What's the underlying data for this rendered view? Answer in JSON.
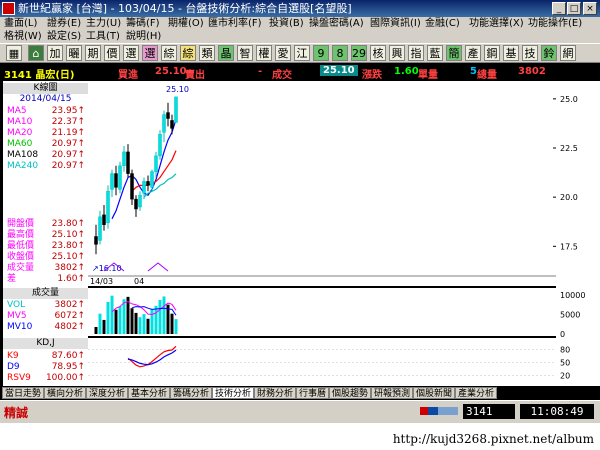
{
  "window": {
    "title": "新世紀贏家 [台灣] - 103/04/15 - 台盤技術分析:綜合自選股[名望股]"
  },
  "menu": {
    "row1": [
      "畫面(L)",
      "證券(E)",
      "主力(U)",
      "籌碼(F)",
      "期權(O)",
      "匯市利率(F)",
      "投資(B)",
      "操盤密碼(A)",
      "國際資訊(I)",
      "金融(C)",
      "功能選擇(X)",
      "功能操作(E)"
    ],
    "row2": [
      "格視(W)",
      "設定(S)",
      "工具(T)",
      "說明(H)"
    ]
  },
  "toolbar": {
    "buttons": [
      {
        "label": "⌂",
        "style": "home"
      },
      {
        "label": "加",
        "style": ""
      },
      {
        "label": "曬",
        "style": ""
      },
      {
        "label": "期",
        "style": ""
      },
      {
        "label": "價",
        "style": ""
      },
      {
        "label": "選",
        "style": ""
      },
      {
        "label": "選",
        "style": "pink"
      },
      {
        "label": "綜",
        "style": ""
      },
      {
        "label": "綜",
        "style": "yellow"
      },
      {
        "label": "類",
        "style": ""
      },
      {
        "label": "晶",
        "style": "green"
      },
      {
        "label": "智",
        "style": ""
      },
      {
        "label": "權",
        "style": ""
      },
      {
        "label": "愛",
        "style": ""
      },
      {
        "label": "江",
        "style": ""
      },
      {
        "label": "9",
        "style": "green"
      },
      {
        "label": "8",
        "style": "green"
      },
      {
        "label": "29",
        "style": "green"
      },
      {
        "label": "核",
        "style": ""
      },
      {
        "label": "興",
        "style": ""
      },
      {
        "label": "指",
        "style": ""
      },
      {
        "label": "藍",
        "style": ""
      },
      {
        "label": "簡",
        "style": "green"
      },
      {
        "label": "產",
        "style": ""
      },
      {
        "label": "鋼",
        "style": ""
      },
      {
        "label": "基",
        "style": ""
      },
      {
        "label": "技",
        "style": ""
      },
      {
        "label": "鈴",
        "style": "green"
      },
      {
        "label": "網",
        "style": ""
      }
    ]
  },
  "quote": {
    "stock": "3141 晶宏(日)",
    "buy_label": "買進",
    "buy_value": "25.10",
    "sell_label": "賣出",
    "sell_value": "-",
    "trade_label": "成交",
    "trade_value": "25.10",
    "change_label": "漲跌",
    "change_value": "1.60",
    "qty_label": "單量",
    "qty_value": "5",
    "total_label": "總量",
    "total_value": "3802"
  },
  "left_panel": {
    "kline_title": "K線圖",
    "date": "2014/04/15",
    "ma": [
      {
        "label": "MA5",
        "value": "23.95",
        "color": "#ff00ff"
      },
      {
        "label": "MA10",
        "value": "22.37",
        "color": "#ff00ff"
      },
      {
        "label": "MA20",
        "value": "21.19",
        "color": "#ff00ff"
      },
      {
        "label": "MA60",
        "value": "20.97",
        "color": "#00c000"
      },
      {
        "label": "MA108",
        "value": "20.97",
        "color": "#000000"
      },
      {
        "label": "MA240",
        "value": "20.97",
        "color": "#00c0c0"
      }
    ],
    "prices": [
      {
        "label": "開盤價",
        "value": "23.80"
      },
      {
        "label": "最高價",
        "value": "25.10"
      },
      {
        "label": "最低價",
        "value": "23.80"
      },
      {
        "label": "收盤價",
        "value": "25.10"
      },
      {
        "label": "成交量",
        "value": "3802"
      },
      {
        "label": "差",
        "value": "1.60"
      }
    ],
    "volume_title": "成交量",
    "volume": [
      {
        "label": "VOL",
        "value": "3802",
        "color": "#00c0c0"
      },
      {
        "label": "MV5",
        "value": "6072",
        "color": "#ff00ff"
      },
      {
        "label": "MV10",
        "value": "4802",
        "color": "#0000ff"
      }
    ],
    "kd_title": "KD,J",
    "kd": [
      {
        "label": "K9",
        "value": "87.60",
        "color": "#ff0000"
      },
      {
        "label": "D9",
        "value": "78.95",
        "color": "#0000ff"
      },
      {
        "label": "RSV9",
        "value": "100.00",
        "color": "#ff0000"
      }
    ]
  },
  "chart_data": {
    "type": "candlestick",
    "price_axis": [
      "25.0",
      "22.5",
      "20.0",
      "17.5"
    ],
    "price_ylim": [
      16.5,
      25.5
    ],
    "high_label": "25.10",
    "low_label": "16.10",
    "date_labels": [
      "14/03",
      "04"
    ],
    "volume_axis": [
      "10000",
      "5000",
      "0"
    ],
    "volume_ylim": [
      0,
      11000
    ],
    "kd_axis": [
      "80",
      "50",
      "20"
    ],
    "kd_ylim": [
      0,
      100
    ],
    "candles": [
      {
        "o": 18.0,
        "h": 18.6,
        "l": 17.1,
        "c": 17.6
      },
      {
        "o": 17.8,
        "h": 19.3,
        "l": 17.6,
        "c": 19.0
      },
      {
        "o": 19.1,
        "h": 19.6,
        "l": 18.3,
        "c": 18.6
      },
      {
        "o": 18.7,
        "h": 20.6,
        "l": 18.4,
        "c": 20.3
      },
      {
        "o": 20.4,
        "h": 21.4,
        "l": 20.0,
        "c": 21.2
      },
      {
        "o": 21.2,
        "h": 21.6,
        "l": 20.1,
        "c": 20.5
      },
      {
        "o": 20.4,
        "h": 21.8,
        "l": 20.2,
        "c": 21.6
      },
      {
        "o": 21.6,
        "h": 22.6,
        "l": 21.3,
        "c": 22.3
      },
      {
        "o": 22.3,
        "h": 22.7,
        "l": 21.0,
        "c": 21.2
      },
      {
        "o": 21.2,
        "h": 21.4,
        "l": 19.6,
        "c": 19.9
      },
      {
        "o": 19.9,
        "h": 20.1,
        "l": 19.0,
        "c": 19.4
      },
      {
        "o": 19.5,
        "h": 20.3,
        "l": 19.3,
        "c": 20.1
      },
      {
        "o": 20.2,
        "h": 21.0,
        "l": 19.9,
        "c": 20.8
      },
      {
        "o": 20.8,
        "h": 21.1,
        "l": 20.3,
        "c": 20.6
      },
      {
        "o": 20.5,
        "h": 21.4,
        "l": 20.3,
        "c": 21.3
      },
      {
        "o": 21.3,
        "h": 22.3,
        "l": 21.0,
        "c": 22.1
      },
      {
        "o": 22.1,
        "h": 23.4,
        "l": 21.9,
        "c": 23.2
      },
      {
        "o": 23.3,
        "h": 24.4,
        "l": 22.8,
        "c": 24.2
      },
      {
        "o": 24.3,
        "h": 24.8,
        "l": 23.6,
        "c": 24.0
      },
      {
        "o": 23.9,
        "h": 24.2,
        "l": 23.2,
        "c": 23.5
      },
      {
        "o": 23.8,
        "h": 25.1,
        "l": 23.8,
        "c": 25.1
      }
    ],
    "ma_lines": [
      {
        "name": "MA5",
        "color": "#0000ff",
        "values": [
          null,
          null,
          null,
          null,
          18.9,
          19.3,
          19.9,
          20.5,
          21.0,
          21.1,
          20.9,
          20.5,
          20.2,
          20.1,
          20.4,
          20.9,
          21.6,
          22.3,
          22.9,
          23.3,
          23.95
        ]
      },
      {
        "name": "MA10",
        "color": "#ff0000",
        "values": [
          null,
          null,
          null,
          null,
          null,
          null,
          null,
          null,
          null,
          20.3,
          20.5,
          20.6,
          20.6,
          20.6,
          20.7,
          20.8,
          21.0,
          21.3,
          21.6,
          21.9,
          22.37
        ]
      },
      {
        "name": "MA20",
        "color": "#00c0c0",
        "values": [
          null,
          null,
          null,
          null,
          null,
          null,
          null,
          null,
          null,
          null,
          null,
          null,
          20.0,
          20.2,
          20.3,
          20.4,
          20.6,
          20.7,
          20.9,
          21.0,
          21.19
        ]
      }
    ],
    "volumes": [
      1800,
      5200,
      3600,
      8200,
      9800,
      6200,
      7100,
      8900,
      9500,
      6600,
      5400,
      4300,
      5100,
      3900,
      6400,
      7200,
      8700,
      9600,
      7500,
      5200,
      3802
    ],
    "mv5": [
      null,
      null,
      null,
      null,
      5700,
      6600,
      7000,
      8000,
      8300,
      7700,
      7500,
      7000,
      6200,
      5100,
      5000,
      5400,
      6300,
      7100,
      7900,
      7600,
      6072
    ],
    "mv10": [
      null,
      null,
      null,
      null,
      null,
      null,
      null,
      null,
      null,
      6700,
      7000,
      6900,
      7000,
      6600,
      6300,
      6400,
      6500,
      6600,
      6400,
      6300,
      4802
    ],
    "k9": [
      null,
      null,
      null,
      null,
      null,
      null,
      null,
      null,
      60,
      52,
      44,
      40,
      42,
      45,
      52,
      60,
      68,
      75,
      78,
      79,
      87.6
    ],
    "d9": [
      null,
      null,
      null,
      null,
      null,
      null,
      null,
      null,
      58,
      56,
      52,
      48,
      46,
      45,
      47,
      51,
      56,
      63,
      68,
      72,
      78.95
    ]
  },
  "tabs": [
    "當日走勢",
    "橫向分析",
    "深度分析",
    "基本分析",
    "籌碼分析",
    "技術分析",
    "財務分析",
    "行事曆",
    "個股趨勢",
    "研報預測",
    "個股新聞",
    "產業分析"
  ],
  "active_tab": 5,
  "status": {
    "brand": "精誠",
    "code": "3141",
    "clock": "11:08:49"
  },
  "footer": {
    "url": "http://kujd3268.pixnet.net/album"
  }
}
